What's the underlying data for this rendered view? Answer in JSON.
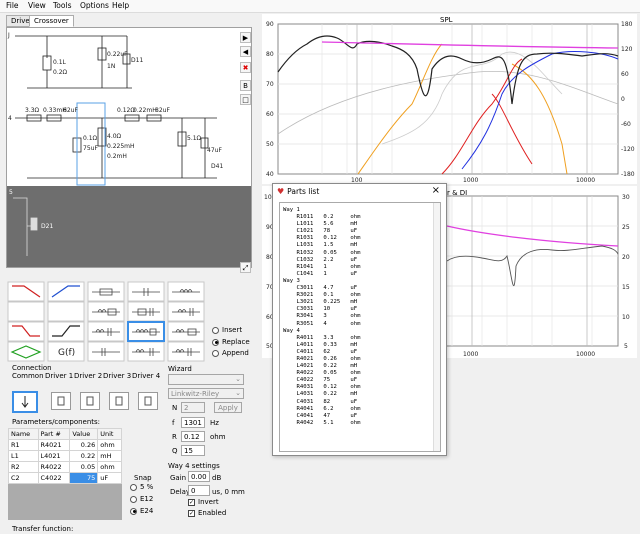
{
  "menu": [
    "File",
    "View",
    "Tools",
    "Options",
    "Help"
  ],
  "tabs": [
    "Drivers",
    "Crossover"
  ],
  "schematic": {
    "labels": [
      "J",
      "0.1L",
      "0.2Ω",
      "0.22uF",
      "D11",
      "1N",
      "3.3Ω",
      "0.33mH",
      "62uF",
      "0.12Ω",
      "0.22mH",
      "82uF",
      "0.1Ω",
      "75uF",
      "4.0Ω",
      "0.225mH",
      "0.2mH",
      "5.1Ω",
      "47uF",
      "D41",
      "D21",
      "4",
      "5"
    ]
  },
  "filters": {
    "options": [
      "Insert",
      "Replace",
      "Append"
    ],
    "selected": "Replace",
    "gf_label": "G(f)"
  },
  "connection": {
    "title": "Connection",
    "columns": [
      "Common",
      "Driver 1",
      "Driver 2",
      "Driver 3",
      "Driver 4"
    ]
  },
  "wizard": {
    "title": "Wizard",
    "type_value": "Linkwitz-Riley",
    "n_label": "N",
    "n_value": "2",
    "apply_label": "Apply",
    "f_label": "f",
    "f_value": "1301",
    "f_unit": "Hz",
    "r_label": "R",
    "r_value": "0.12",
    "r_unit": "ohm",
    "q_label": "Q",
    "q_value": "15"
  },
  "params": {
    "title": "Parameters/components:",
    "headers": [
      "Name",
      "Part #",
      "Value",
      "Unit"
    ],
    "rows": [
      [
        "R1",
        "R4021",
        "0.26",
        "ohm"
      ],
      [
        "L1",
        "L4021",
        "0.22",
        "mH"
      ],
      [
        "R2",
        "R4022",
        "0.05",
        "ohm"
      ],
      [
        "C2",
        "C4022",
        "75",
        "uF"
      ]
    ]
  },
  "snap": {
    "title": "Snap",
    "options": [
      "5 %",
      "E12",
      "E24"
    ],
    "selected": "E24"
  },
  "way4": {
    "title": "Way 4 settings",
    "gain_label": "Gain",
    "gain_value": "0.00",
    "gain_unit": "dB",
    "delay_label": "Delay",
    "delay_value": "0",
    "delay_unit": "us, 0 mm",
    "invert_label": "Invert",
    "enabled_label": "Enabled"
  },
  "transfer_label": "Transfer function:",
  "spl": {
    "title": "SPL",
    "y_left": [
      "90",
      "80",
      "70",
      "60",
      "50",
      "40"
    ],
    "y_right": [
      "180",
      "120",
      "60",
      "0",
      "-60",
      "-120",
      "-180"
    ],
    "x_ticks": [
      "100",
      "1000",
      "10000"
    ]
  },
  "di": {
    "title_visible": "r & DI",
    "y_left": [
      "100",
      "90",
      "80",
      "70",
      "60",
      "50"
    ],
    "y_right": [
      "30",
      "25",
      "20",
      "15",
      "10",
      "5"
    ],
    "x_ticks": [
      "1000",
      "10000"
    ]
  },
  "parts_list": {
    "title": "Parts list",
    "close": "×",
    "lines": [
      "Way 1",
      "    R1011   0.2     ohm",
      "    L1011   5.6     mH",
      "    C1021   78      uF",
      "    R1031   0.12    ohm",
      "    L1031   1.5     mH",
      "    R1032   0.05    ohm",
      "    C1032   2.2     uF",
      "    R1041   1       ohm",
      "    C1041   1       uF",
      "Way 3",
      "    C3011   4.7     uF",
      "    R3021   0.1     ohm",
      "    L3021   0.225   mH",
      "    C3031   10      uF",
      "    R3041   3       ohm",
      "    R3051   4       ohm",
      "Way 4",
      "    R4011   3.3     ohm",
      "    L4011   0.33    mH",
      "    C4011   62      uF",
      "    R4021   0.26    ohm",
      "    L4021   0.22    mH",
      "    R4022   0.05    ohm",
      "    C4022   75      uF",
      "    R4031   0.12    ohm",
      "    L4031   0.22    mH",
      "    C4031   82      uF",
      "    R4041   6.2     ohm",
      "    C4041   47      uF",
      "    R4042   5.1     ohm"
    ]
  },
  "colors": {
    "magenta": "#e040e0",
    "blue": "#2030e0",
    "red": "#e02020",
    "orange": "#f0a020",
    "black": "#222222",
    "selected": "#3a8ee6"
  }
}
